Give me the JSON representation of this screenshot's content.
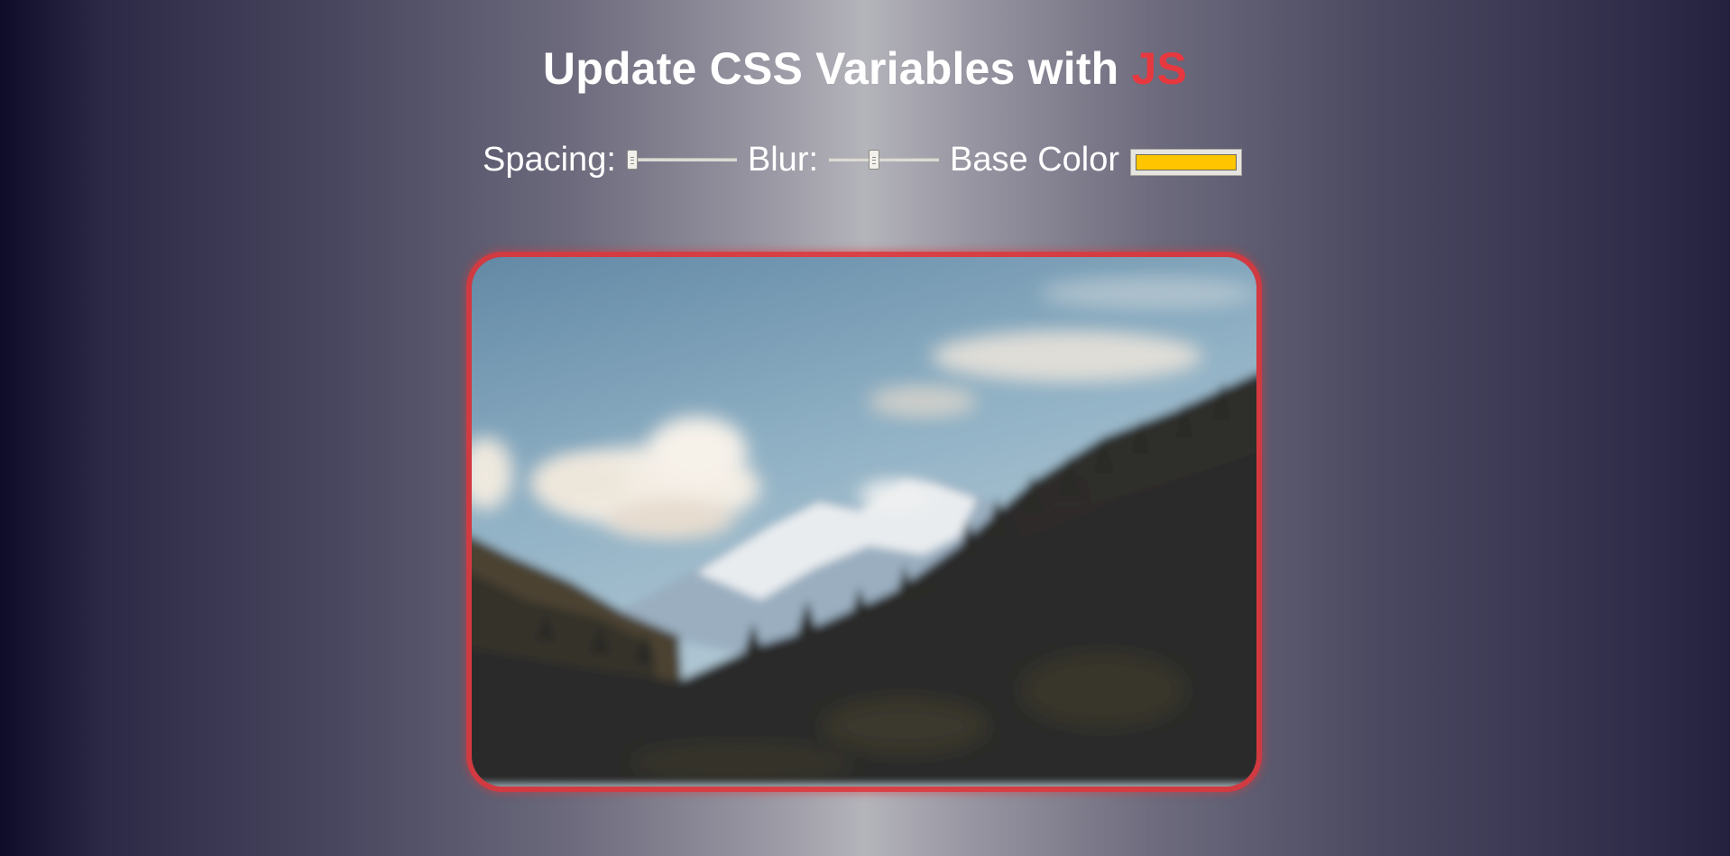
{
  "header": {
    "title_main": "Update CSS Variables with ",
    "title_highlight": "JS"
  },
  "controls": {
    "spacing_label": "Spacing:",
    "spacing_value": 10,
    "spacing_min": 10,
    "spacing_max": 200,
    "blur_label": "Blur:",
    "blur_value": 10,
    "blur_min": 0,
    "blur_max": 25,
    "base_color_label": "Base Color",
    "base_color_value": "#ffc600"
  },
  "image": {
    "icon": "mountain-landscape-photo",
    "accent_border_color": "#e8383f"
  },
  "colors": {
    "title_highlight": "#e8383f",
    "base_color": "#ffc600"
  }
}
